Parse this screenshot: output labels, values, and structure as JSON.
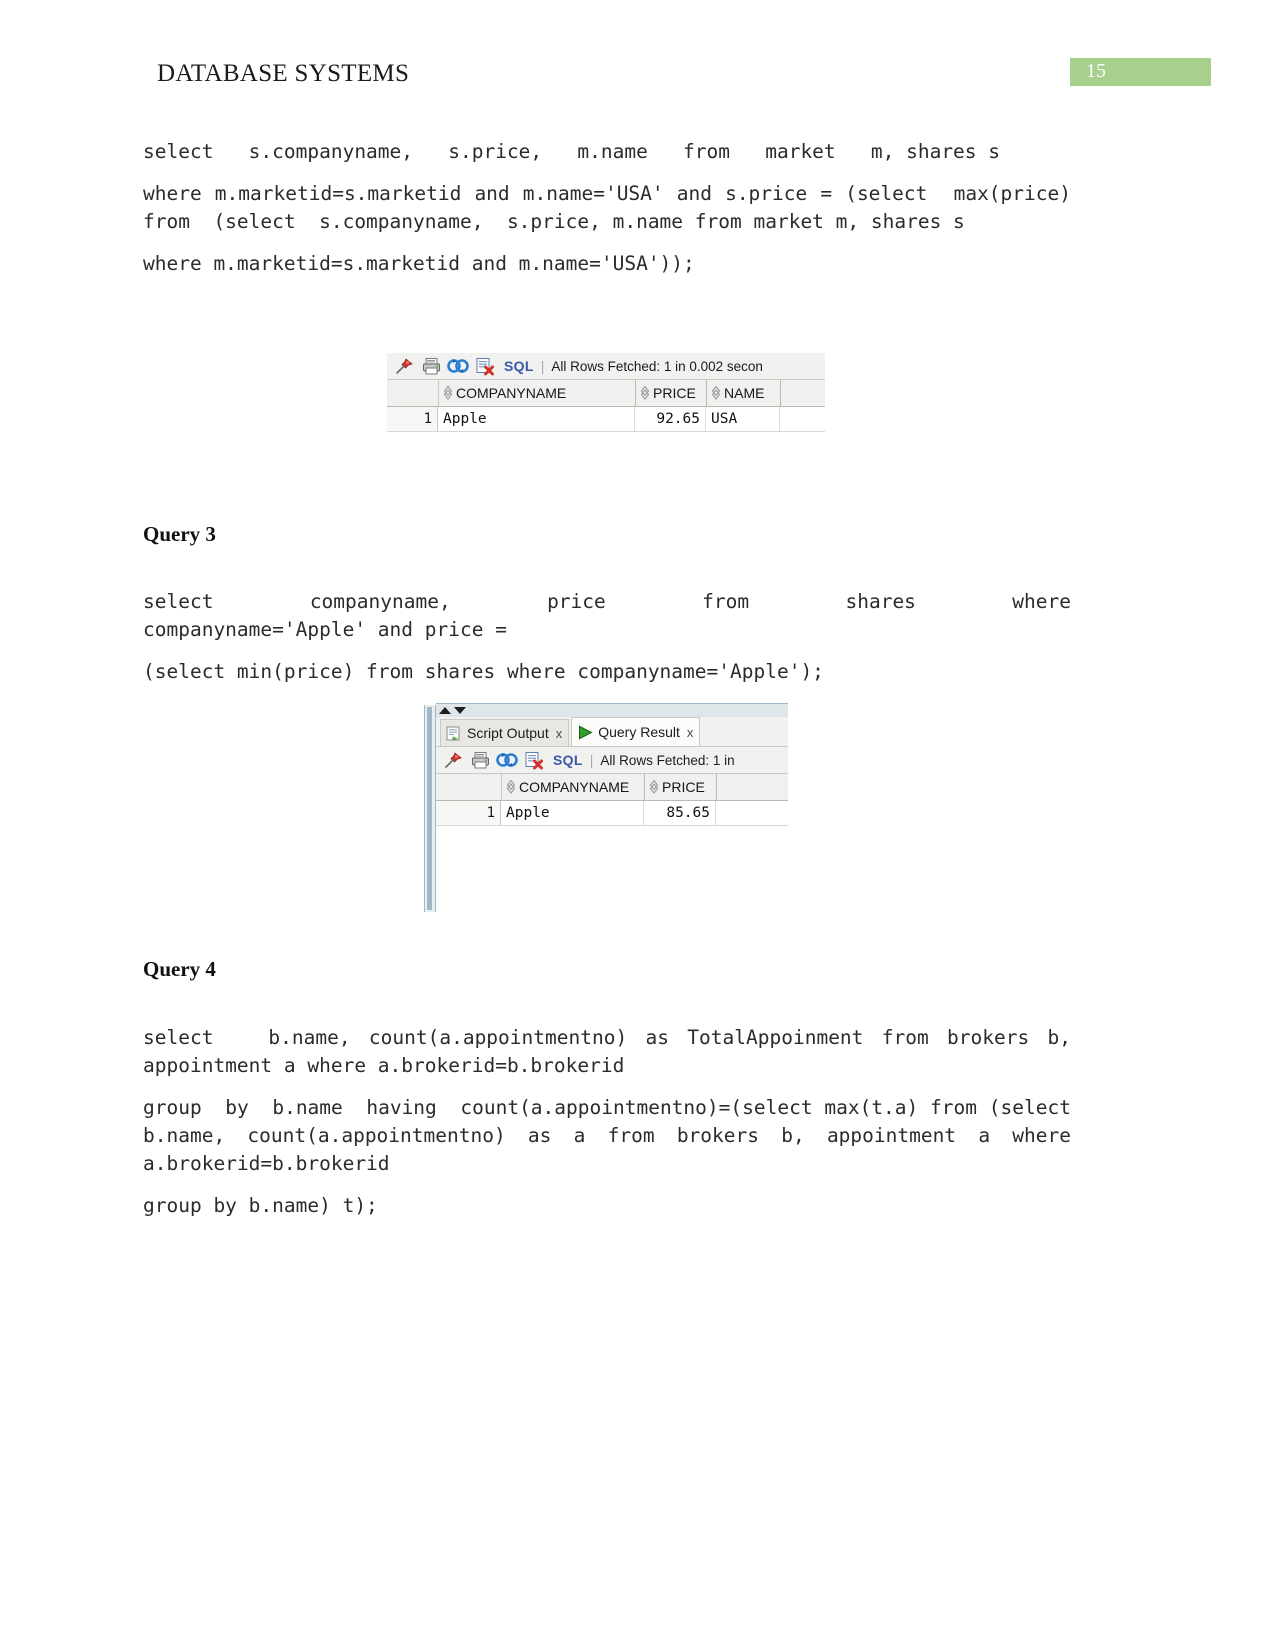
{
  "header": {
    "doc_title": "DATABASE SYSTEMS",
    "page_number": "15",
    "badge_color": "#a8d08d"
  },
  "content": {
    "query2": {
      "code_line_1": "select   s.companyname,   s.price,   m.name   from   market   m, shares s",
      "code_line_2": "where m.marketid=s.marketid and m.name='USA' and s.price = (select  max(price)  from  (select  s.companyname,  s.price, m.name from market m, shares s",
      "code_line_3": "where m.marketid=s.marketid and m.name='USA'));"
    },
    "query3": {
      "heading": "Query 3",
      "code_line_1": "select     companyname,     price     from     shares     where companyname='Apple' and price =",
      "code_line_2": "(select min(price) from shares where companyname='Apple');"
    },
    "query4": {
      "heading": "Query 4",
      "code_line_1": "select   b.name, count(a.appointmentno) as TotalAppoinment from brokers b, appointment a where a.brokerid=b.brokerid",
      "code_line_2": "group  by  b.name  having  count(a.appointmentno)=(select max(t.a) from (select b.name, count(a.appointmentno) as a from brokers b, appointment a where a.brokerid=b.brokerid",
      "code_line_3": "group by b.name) t);"
    }
  },
  "result_panel_1": {
    "toolbar": {
      "pin_icon": "pin-icon",
      "print_icon": "printer-icon",
      "refresh_icon": "refresh-icon",
      "clear_icon": "clear-results-icon",
      "sql_label": "SQL",
      "separator": "|",
      "status": "All Rows Fetched: 1 in 0.002 secon"
    },
    "columns": [
      "COMPANYNAME",
      "PRICE",
      "NAME"
    ],
    "rows": [
      {
        "num": "1",
        "COMPANYNAME": "Apple",
        "PRICE": "92.65",
        "NAME": "USA"
      }
    ]
  },
  "result_panel_2": {
    "tabs": [
      {
        "label": "Script Output",
        "icon": "script-output-icon",
        "close": "x",
        "active": false
      },
      {
        "label": "Query Result",
        "icon": "play-triangle-icon",
        "close": "x",
        "active": true
      }
    ],
    "toolbar": {
      "pin_icon": "pin-icon",
      "print_icon": "printer-icon",
      "refresh_icon": "refresh-icon",
      "clear_icon": "clear-results-icon",
      "sql_label": "SQL",
      "separator": "|",
      "status": "All Rows Fetched: 1 in"
    },
    "columns": [
      "COMPANYNAME",
      "PRICE"
    ],
    "rows": [
      {
        "num": "1",
        "COMPANYNAME": "Apple",
        "PRICE": "85.65"
      }
    ]
  }
}
